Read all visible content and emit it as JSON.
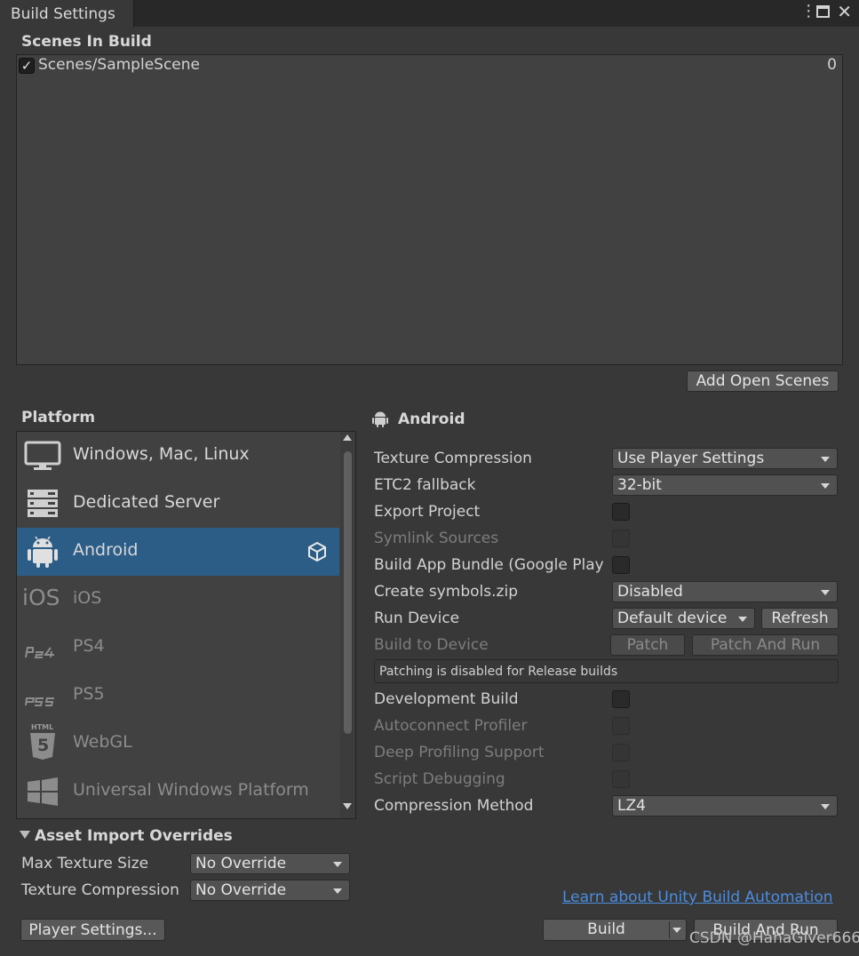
{
  "window": {
    "tab_title": "Build Settings"
  },
  "scenes": {
    "title": "Scenes In Build",
    "items": [
      {
        "name": "Scenes/SampleScene",
        "index": "0",
        "checked": true
      }
    ],
    "add_open_scenes": "Add Open Scenes"
  },
  "platform": {
    "title": "Platform",
    "items": [
      {
        "label": "Windows, Mac, Linux",
        "icon": "monitor-icon"
      },
      {
        "label": "Dedicated Server",
        "icon": "server-icon"
      },
      {
        "label": "Android",
        "icon": "android-icon",
        "selected": true
      },
      {
        "label": "iOS",
        "icon": "ios-icon"
      },
      {
        "label": "PS4",
        "icon": "ps4-icon"
      },
      {
        "label": "PS5",
        "icon": "ps5-icon"
      },
      {
        "label": "WebGL",
        "icon": "html5-icon"
      },
      {
        "label": "Universal Windows Platform",
        "icon": "windows-icon"
      }
    ],
    "ios_glyph": "iOS",
    "html_glyph": "HTML",
    "html_num": "5"
  },
  "android": {
    "title": "Android",
    "texture_compression": {
      "label": "Texture Compression",
      "value": "Use Player Settings"
    },
    "etc2_fallback": {
      "label": "ETC2 fallback",
      "value": "32-bit"
    },
    "export_project": {
      "label": "Export Project"
    },
    "symlink_sources": {
      "label": "Symlink Sources"
    },
    "build_app_bundle": {
      "label": "Build App Bundle (Google Play"
    },
    "create_symbols": {
      "label": "Create symbols.zip",
      "value": "Disabled"
    },
    "run_device": {
      "label": "Run Device",
      "value": "Default device",
      "refresh": "Refresh"
    },
    "build_to_device": {
      "label": "Build to Device",
      "patch": "Patch",
      "patch_and_run": "Patch And Run"
    },
    "patch_info": "Patching is disabled for Release builds",
    "development_build": {
      "label": "Development Build"
    },
    "autoconnect_profiler": {
      "label": "Autoconnect Profiler"
    },
    "deep_profiling": {
      "label": "Deep Profiling Support"
    },
    "script_debugging": {
      "label": "Script Debugging"
    },
    "compression_method": {
      "label": "Compression Method",
      "value": "LZ4"
    }
  },
  "asset_overrides": {
    "title": "Asset Import Overrides",
    "max_texture_size": {
      "label": "Max Texture Size",
      "value": "No Override"
    },
    "texture_compression": {
      "label": "Texture Compression",
      "value": "No Override"
    }
  },
  "footer": {
    "learn_link": "Learn about Unity Build Automation",
    "player_settings": "Player Settings...",
    "build": "Build",
    "build_and_run": "Build And Run",
    "watermark": "CSDN @HahaGiver666"
  },
  "colors": {
    "background": "#383838",
    "selected": "#2c5d87",
    "link": "#4c8dde"
  }
}
